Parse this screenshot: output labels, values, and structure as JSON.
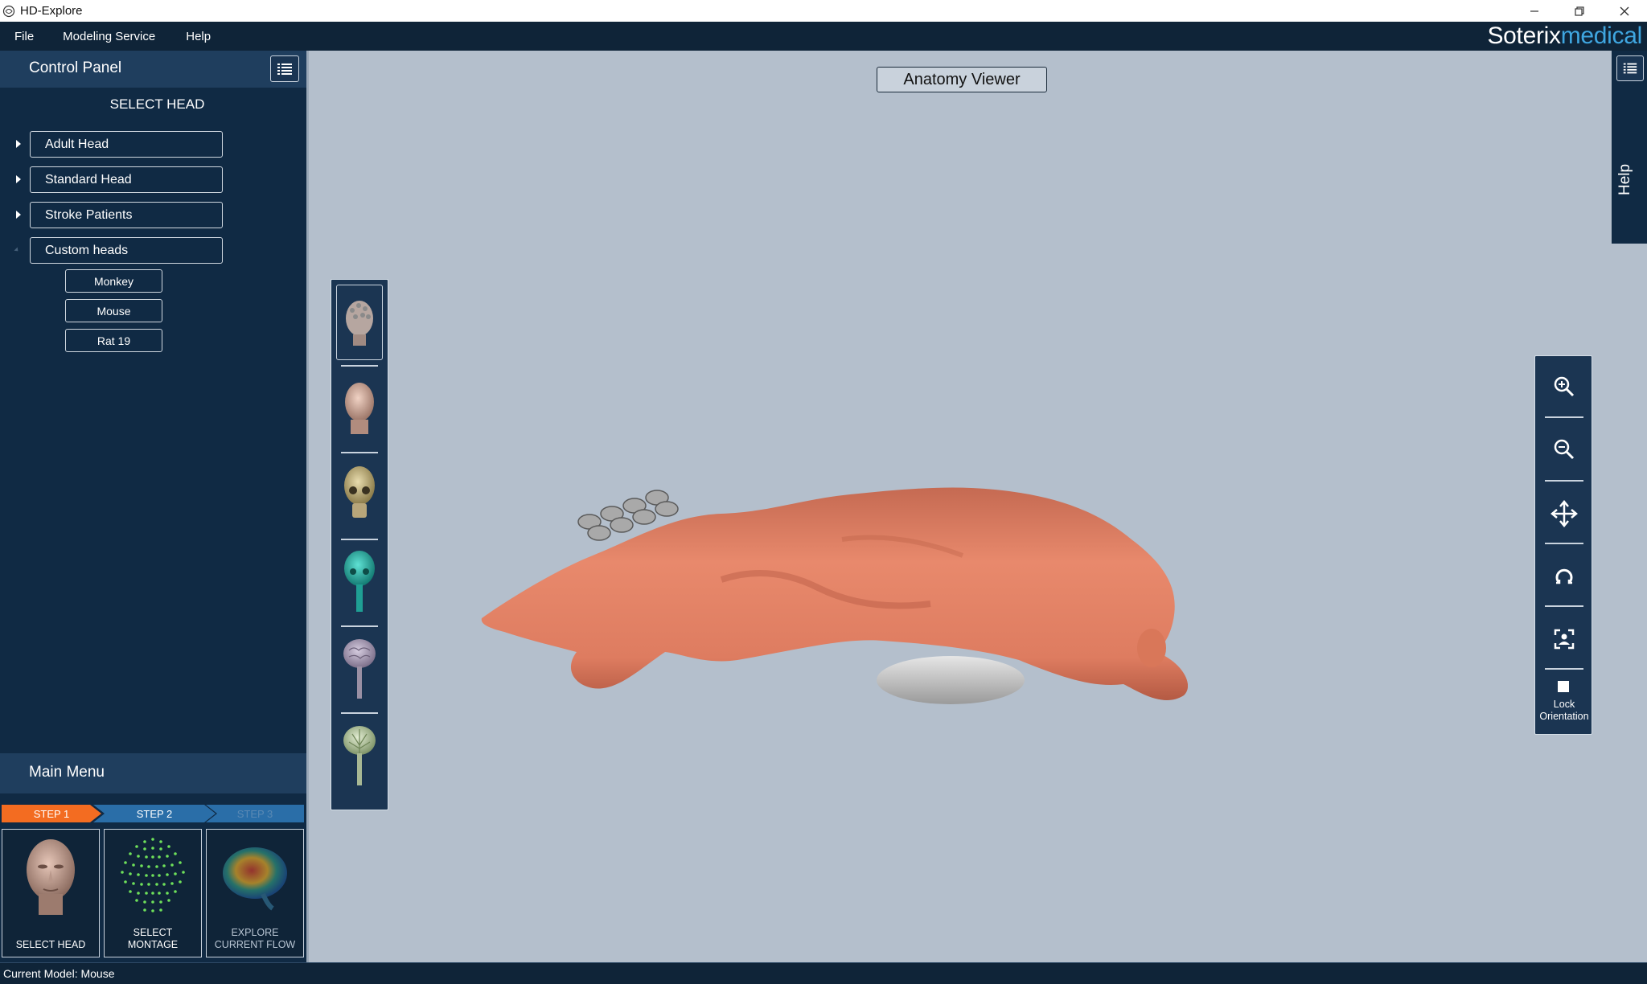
{
  "window": {
    "title": "HD-Explore"
  },
  "menu": {
    "items": [
      "File",
      "Modeling Service",
      "Help"
    ]
  },
  "brand": {
    "part1": "Soterix",
    "part2": "medical"
  },
  "control_panel": {
    "title": "Control Panel",
    "section_title": "SELECT HEAD",
    "heads": [
      {
        "label": "Adult Head"
      },
      {
        "label": "Standard Head"
      },
      {
        "label": "Stroke Patients"
      },
      {
        "label": "Custom heads"
      }
    ],
    "custom_heads": [
      "Monkey",
      "Mouse",
      "Rat 19"
    ]
  },
  "main_menu": {
    "title": "Main Menu",
    "steps": [
      "STEP 1",
      "STEP 2",
      "STEP 3"
    ],
    "tiles": [
      {
        "line1": "SELECT HEAD",
        "line2": ""
      },
      {
        "line1": "SELECT",
        "line2": "MONTAGE"
      },
      {
        "line1": "EXPLORE",
        "line2": "CURRENT FLOW"
      }
    ]
  },
  "viewer": {
    "title": "Anatomy Viewer",
    "layers": [
      "head-mesh-layer",
      "skin-layer",
      "skull-layer",
      "csf-layer",
      "brain-layer",
      "white-matter-layer"
    ],
    "tools": [
      "zoom-in-icon",
      "zoom-out-icon",
      "pan-icon",
      "rotate-icon",
      "fit-view-icon"
    ],
    "lock_label": [
      "Lock",
      "Orientation"
    ]
  },
  "right_panel": {
    "help_label": "Help"
  },
  "status": {
    "text": "Current Model: Mouse"
  },
  "colors": {
    "accent_orange": "#f36c21",
    "panel_dark": "#102a44",
    "viewer_bg": "#b4bfcc",
    "model_skin": "#e0856c",
    "brand_blue": "#3fa6e0"
  }
}
